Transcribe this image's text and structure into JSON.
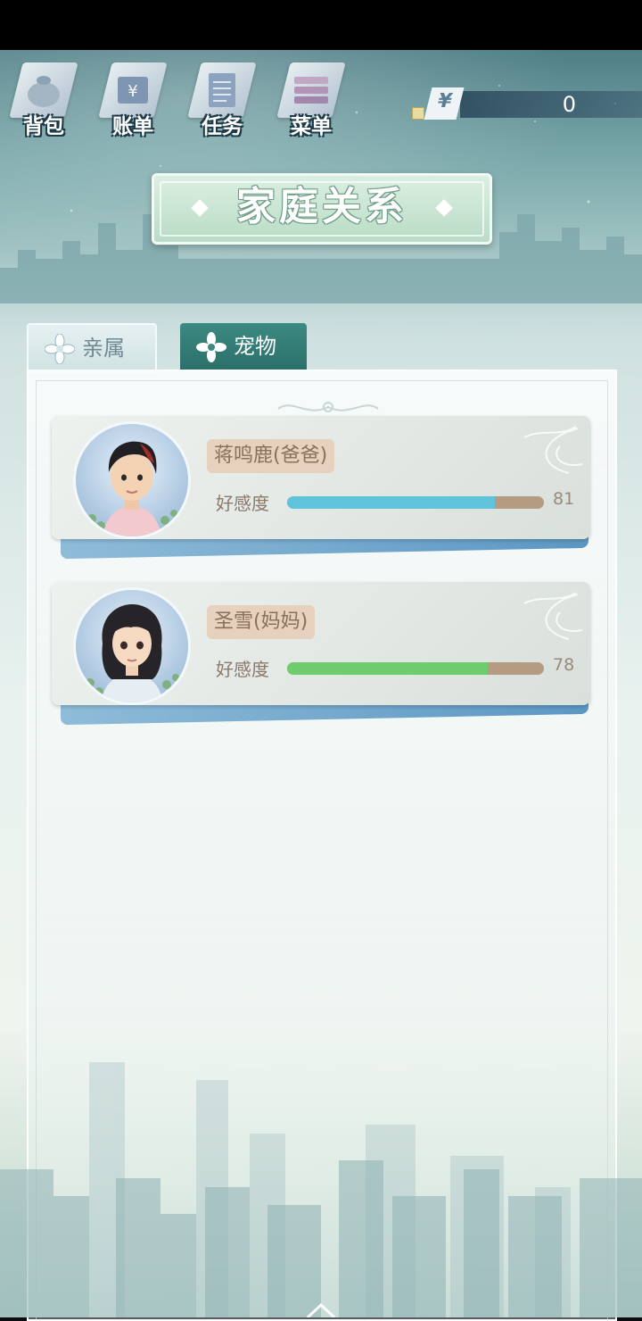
{
  "toolbar": {
    "buttons": [
      {
        "label": "背包",
        "icon": "bag-icon"
      },
      {
        "label": "账单",
        "icon": "bill-icon"
      },
      {
        "label": "任务",
        "icon": "task-icon"
      },
      {
        "label": "菜单",
        "icon": "menu-icon"
      }
    ]
  },
  "currency": {
    "symbol": "¥",
    "amount": "0"
  },
  "title": "家庭关系",
  "tabs": [
    {
      "label": "亲属",
      "icon": "flower-icon",
      "selected": false
    },
    {
      "label": "宠物",
      "icon": "flower-icon",
      "selected": true
    }
  ],
  "family": [
    {
      "name": "蒋鸣鹿(爸爸)",
      "affinity_label": "好感度",
      "affinity": 81,
      "bar_color": "#5fc3dc"
    },
    {
      "name": "圣雪(妈妈)",
      "affinity_label": "好感度",
      "affinity": 78,
      "bar_color": "#6ecb6e"
    }
  ]
}
